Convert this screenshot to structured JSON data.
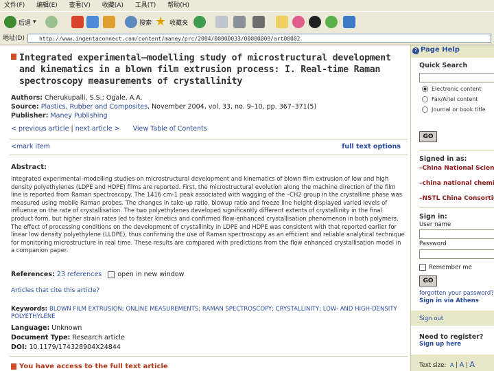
{
  "browser": {
    "menu": [
      "文件(F)",
      "编辑(E)",
      "查看(V)",
      "收藏(A)",
      "工具(T)",
      "帮助(H)"
    ],
    "back_label": "后退",
    "search_label": "搜索",
    "favorites_label": "收藏夹",
    "address_label": "地址(D)",
    "address_value": "http://www.ingentaconnect.com/content/maney/prc/2004/00000033/00000009/art00002"
  },
  "article": {
    "title": "Integrated experimental–modelling study of microstructural development and kinematics in a blown film extrusion process: I. Real-time Raman spectroscopy measurements of crystallinity",
    "authors_label": "Authors:",
    "authors": "Cherukupalli, S.S.; Ogale, A.A.",
    "source_label": "Source:",
    "source_journal": "Plastics, Rubber and Composites",
    "source_rest": ", November 2004, vol. 33, no. 9–10, pp. 367–371(5)",
    "publisher_label": "Publisher:",
    "publisher": "Maney Publishing",
    "prev": "< previous article",
    "next": "next article >",
    "toc": "View Table of Contents",
    "mark_item": "<mark item",
    "full_text": "full text options",
    "abstract_label": "Abstract:",
    "abstract": "Integrated experimental–modelling studies on microstructural development and kinematics of blown film extrusion of low and high density polyethylenes (LDPE and HDPE) films are reported. First, the microstructural evolution along the machine direction of the film line is reported from Raman spectroscopy. The 1416 cm-1 peak associated with wagging of the –CH2 group in the crystalline phase was measured using mobile Raman probes. The changes in take-up ratio, blowup ratio and freeze line height displayed varied levels of influence on the rate of crystallisation. The two polyethylenes developed significantly different extents of crystallinity in the final product form, but higher strain rates led to faster kinetics and confirmed flow-enhanced crystallisation phenomenon in both polymers. The effect of processing conditions on the development of crystallinity in LDPE and HDPE was consistent with that reported earlier for linear low density polyethylene (LLDPE), thus confirming the use of Raman spectroscopy as an efficient and reliable analytical technique for monitoring microstructure in real time. These results are compared with predictions from the flow enhanced crystallisation model in a companion paper.",
    "references_label": "References:",
    "references_link": "23 references",
    "new_window": "open in new window",
    "cites_link": "Articles that cite this article?",
    "keywords_label": "Keywords:",
    "keywords": "BLOWN FILM EXTRUSION; ONLINE MEASUREMENTS; RAMAN SPECTROSCOPY; CRYSTALLINITY; LOW- AND HIGH-DENSITY POLYETHYLENE",
    "language_label": "Language:",
    "language": "Unknown",
    "doctype_label": "Document Type:",
    "doctype": "Research article",
    "doi_label": "DOI:",
    "doi": "10.1179/174328904X24844",
    "access_notice": "You have access to the full text article"
  },
  "sidebar": {
    "help": "Page Help",
    "quick_search": "Quick Search",
    "radio_options": [
      "Electronic content",
      "Fax/Ariel content",
      "Journal or book title"
    ],
    "go": "GO",
    "signed_in_as": "Signed in as:",
    "orgs": [
      "–China National Science Committee",
      "–china national chemical information center",
      "–NSTL China Consortium"
    ],
    "sign_in": "Sign in:",
    "user_name": "User name",
    "password": "Password",
    "remember": "Remember me",
    "forgotten": "forgotten your password?",
    "athens": "Sign in via Athens",
    "sign_out": "Sign out",
    "need_reg": "Need to register?",
    "sign_up": "Sign up here",
    "text_size_label": "Text size:",
    "text_size_options": [
      "A",
      "A",
      "A"
    ]
  }
}
